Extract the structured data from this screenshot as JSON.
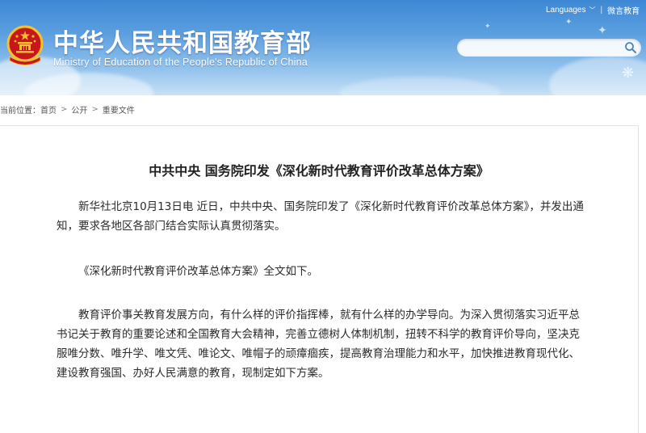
{
  "header": {
    "site_title": "中华人民共和国教育部",
    "site_subtitle": "Ministry of Education of the People's Republic of China",
    "languages_label": "Languages",
    "weibo_label": "微言教育",
    "search": {
      "value": "",
      "placeholder": ""
    }
  },
  "breadcrumb": {
    "prefix": "当前位置：",
    "items": [
      "首页",
      "公开",
      "重要文件"
    ]
  },
  "article": {
    "title": "中共中央 国务院印发《深化新时代教育评价改革总体方案》",
    "paragraphs": [
      "新华社北京10月13日电 近日，中共中央、国务院印发了《深化新时代教育评价改革总体方案》，并发出通知，要求各地区各部门结合实际认真贯彻落实。",
      "《深化新时代教育评价改革总体方案》全文如下。",
      "教育评价事关教育发展方向，有什么样的评价指挥棒，就有什么样的办学导向。为深入贯彻落实习近平总书记关于教育的重要论述和全国教育大会精神，完善立德树人体制机制，扭转不科学的教育评价导向，坚决克服唯分数、唯升学、唯文凭、唯论文、唯帽子的顽瘴痼疾，提高教育治理能力和水平，加快推进教育现代化、建设教育强国、办好人民满意的教育，现制定如下方案。"
    ]
  },
  "colors": {
    "banner_top": "#3d87d4",
    "banner_bottom": "#c7e0f6",
    "emblem_red": "#c8161d",
    "emblem_gold": "#f2c230"
  }
}
